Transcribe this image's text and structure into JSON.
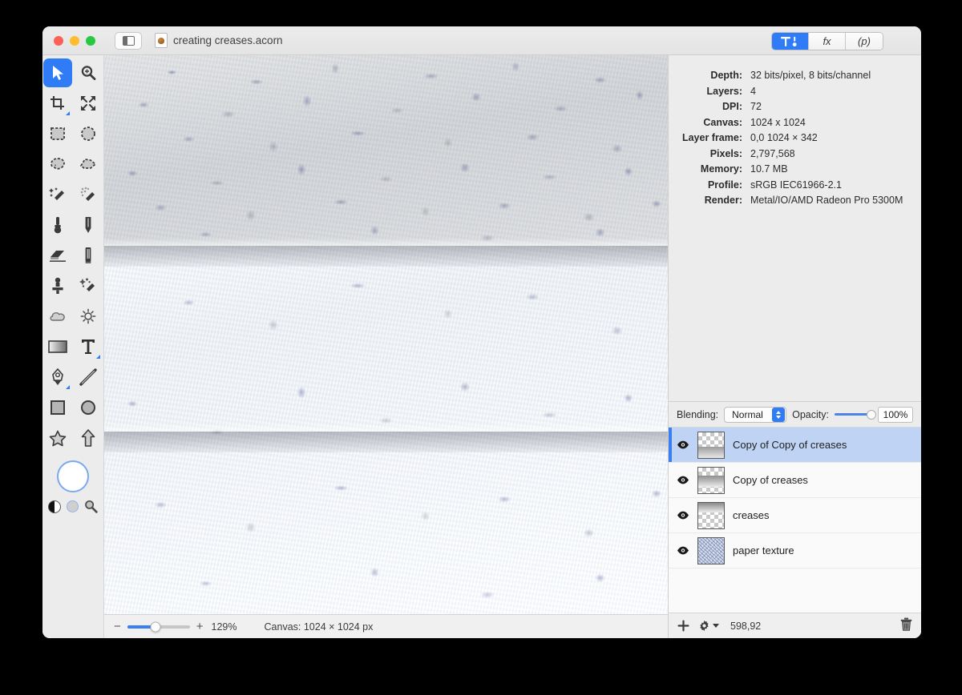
{
  "window": {
    "title": "creating creases.acorn",
    "traffic_lights": [
      "close",
      "minimize",
      "maximize"
    ],
    "sidebar_toggle": "sidebar-toggle"
  },
  "inspector_tabs": [
    {
      "id": "tools",
      "label": "⚒",
      "active": true
    },
    {
      "id": "filters",
      "label": "fx",
      "active": false
    },
    {
      "id": "presets",
      "label": "(p)",
      "active": false
    }
  ],
  "tools": [
    {
      "name": "move-tool",
      "selected": true
    },
    {
      "name": "zoom-tool",
      "selected": false
    },
    {
      "name": "crop-tool",
      "selected": false
    },
    {
      "name": "transform-tool",
      "selected": false
    },
    {
      "name": "rectangular-select-tool",
      "selected": false
    },
    {
      "name": "elliptical-select-tool",
      "selected": false
    },
    {
      "name": "lasso-tool",
      "selected": false
    },
    {
      "name": "polygon-lasso-tool",
      "selected": false
    },
    {
      "name": "magic-wand-tool",
      "selected": false
    },
    {
      "name": "instant-alpha-tool",
      "selected": false
    },
    {
      "name": "brush-tool",
      "selected": false
    },
    {
      "name": "pencil-tool",
      "selected": false
    },
    {
      "name": "eraser-tool",
      "selected": false
    },
    {
      "name": "marker-tool",
      "selected": false
    },
    {
      "name": "clone-stamp-tool",
      "selected": false
    },
    {
      "name": "smudge-tool",
      "selected": false
    },
    {
      "name": "dodge-tool",
      "selected": false
    },
    {
      "name": "burn-tool",
      "selected": false
    },
    {
      "name": "gradient-tool",
      "selected": false
    },
    {
      "name": "text-tool",
      "selected": false
    },
    {
      "name": "bezier-pen-tool",
      "selected": false
    },
    {
      "name": "line-tool",
      "selected": false
    },
    {
      "name": "rectangle-shape-tool",
      "selected": false
    },
    {
      "name": "ellipse-shape-tool",
      "selected": false
    },
    {
      "name": "star-shape-tool",
      "selected": false
    },
    {
      "name": "arrow-shape-tool",
      "selected": false
    }
  ],
  "color_controls": {
    "foreground_color": "#ffffff",
    "swap_colors": "swap-colors-icon",
    "background_color": "#cfcfcf",
    "color_picker": "eyedropper-icon"
  },
  "info": {
    "rows": [
      {
        "key": "Depth:",
        "value": "32 bits/pixel, 8 bits/channel"
      },
      {
        "key": "Layers:",
        "value": "4"
      },
      {
        "key": "DPI:",
        "value": "72"
      },
      {
        "key": "Canvas:",
        "value": "1024 x 1024"
      },
      {
        "key": "Layer frame:",
        "value": "0,0 1024 × 342"
      },
      {
        "key": "Pixels:",
        "value": "2,797,568"
      },
      {
        "key": "Memory:",
        "value": "10.7 MB"
      },
      {
        "key": "Profile:",
        "value": "sRGB IEC61966-2.1"
      },
      {
        "key": "Render:",
        "value": "Metal/IO/AMD Radeon Pro 5300M"
      }
    ]
  },
  "blending": {
    "label": "Blending:",
    "mode": "Normal",
    "opacity_label": "Opacity:",
    "opacity_value": "100%",
    "opacity_percent": 100
  },
  "layers": [
    {
      "name": "Copy of Copy of creases",
      "visible": true,
      "selected": true,
      "thumb": "gradient-bottom"
    },
    {
      "name": "Copy of creases",
      "visible": true,
      "selected": false,
      "thumb": "gradient-middle"
    },
    {
      "name": "creases",
      "visible": true,
      "selected": false,
      "thumb": "gradient-top"
    },
    {
      "name": "paper texture",
      "visible": true,
      "selected": false,
      "thumb": "noise"
    }
  ],
  "layer_footer": {
    "add": "add-layer-icon",
    "settings": "layer-settings-icon",
    "coordinates": "598,92",
    "delete": "delete-layer-icon"
  },
  "status_bar": {
    "zoom_out": "−",
    "zoom_in": "+",
    "zoom_level": "129%",
    "zoom_percent": 45,
    "canvas_size": "Canvas: 1024 × 1024 px"
  },
  "canvas": {
    "bands": [
      {
        "name": "band-top",
        "crease_below": true
      },
      {
        "name": "band-middle",
        "crease_below": true
      },
      {
        "name": "band-bottom",
        "crease_below": false
      }
    ]
  }
}
